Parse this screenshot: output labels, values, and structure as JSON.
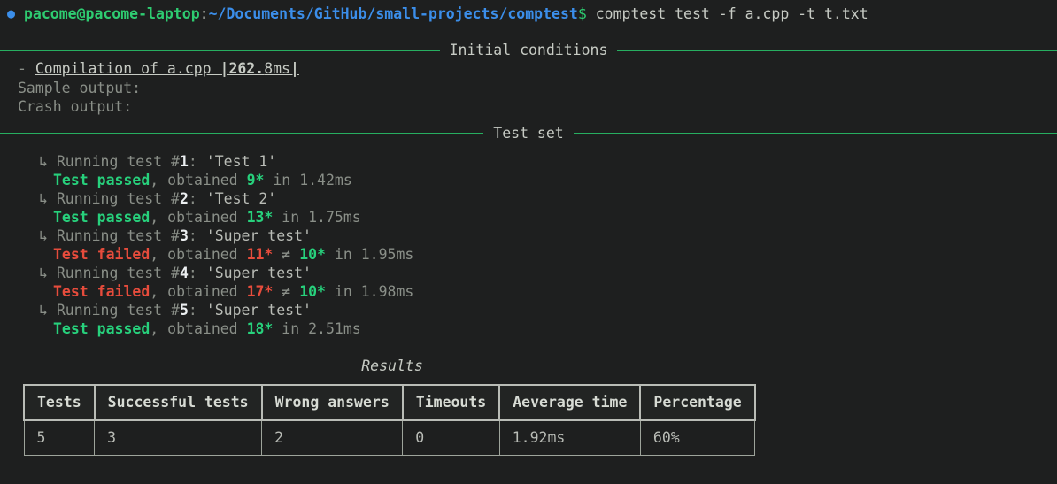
{
  "terminal": {
    "background": "#1e1f1f",
    "prompt": {
      "bullet": "bullet-icon",
      "user_host": "pacome@pacome-laptop",
      "separator": ":",
      "path": "~/Documents/GitHub/small-projects/comptest",
      "sigil": "$",
      "command": "comptest test -f a.cpp -t t.txt"
    },
    "sections": [
      {
        "label": "Initial conditions"
      },
      {
        "label": "Test set"
      }
    ],
    "initial_conditions": {
      "compilation_bullet": "- ",
      "compilation_label": "Compilation of a.cpp ",
      "compilation_time_open": "|",
      "compilation_time_value": "262.",
      "compilation_time_unit": "8ms",
      "compilation_time_close": "|",
      "sample_output_label": "Sample output:",
      "crash_output_label": "Crash output:"
    },
    "tests": [
      {
        "arrow": "↳",
        "running_prefix": " Running test #",
        "index": "1",
        "running_suffix": ": ",
        "name": "'Test 1'",
        "status": "Test passed",
        "status_kind": "passed",
        "obtained_label": ", obtained ",
        "obtained": "9*",
        "expected": "",
        "neq": "",
        "time_prefix": " in ",
        "time": "1.42ms"
      },
      {
        "arrow": "↳",
        "running_prefix": " Running test #",
        "index": "2",
        "running_suffix": ": ",
        "name": "'Test 2'",
        "status": "Test passed",
        "status_kind": "passed",
        "obtained_label": ", obtained ",
        "obtained": "13*",
        "expected": "",
        "neq": "",
        "time_prefix": " in ",
        "time": "1.75ms"
      },
      {
        "arrow": "↳",
        "running_prefix": " Running test #",
        "index": "3",
        "running_suffix": ": ",
        "name": "'Super test'",
        "status": "Test failed",
        "status_kind": "failed",
        "obtained_label": ", obtained ",
        "obtained": "11*",
        "neq": " ≠ ",
        "expected": "10*",
        "time_prefix": " in ",
        "time": "1.95ms"
      },
      {
        "arrow": "↳",
        "running_prefix": " Running test #",
        "index": "4",
        "running_suffix": ": ",
        "name": "'Super test'",
        "status": "Test failed",
        "status_kind": "failed",
        "obtained_label": ", obtained ",
        "obtained": "17*",
        "neq": " ≠ ",
        "expected": "10*",
        "time_prefix": " in ",
        "time": "1.98ms"
      },
      {
        "arrow": "↳",
        "running_prefix": " Running test #",
        "index": "5",
        "running_suffix": ": ",
        "name": "'Super test'",
        "status": "Test passed",
        "status_kind": "passed",
        "obtained_label": ", obtained ",
        "obtained": "18*",
        "neq": "",
        "expected": "",
        "time_prefix": " in ",
        "time": "2.51ms"
      }
    ],
    "results": {
      "title": "Results",
      "columns": [
        "Tests",
        "Successful tests",
        "Wrong answers",
        "Timeouts",
        "Aeverage time",
        "Percentage"
      ],
      "row": {
        "tests": "5",
        "successful_tests": "3",
        "wrong_answers": "2",
        "timeouts": "0",
        "average_time": "1.92ms",
        "percentage": "60%"
      }
    },
    "colors": {
      "green": "#27d17c",
      "rule_green": "#27ae60",
      "red": "#e74c3c",
      "blue": "#3b8eea",
      "amber": "#e8a317",
      "dim": "#8a8f88",
      "fg": "#b9bcb6"
    }
  }
}
